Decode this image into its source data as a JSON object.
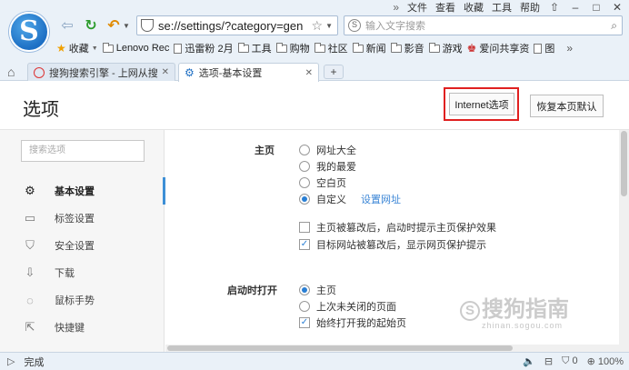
{
  "menubar": {
    "more": "»",
    "items": [
      "文件",
      "查看",
      "收藏",
      "工具",
      "帮助"
    ],
    "skin": "⇧",
    "minimize": "–",
    "maximize": "□",
    "close": "✕"
  },
  "logo": {
    "letter": "S"
  },
  "address": {
    "url": "se://settings/?category=gen"
  },
  "search": {
    "placeholder": "输入文字搜索"
  },
  "bookmarks": {
    "favorites": "收藏",
    "items": [
      "Lenovo Rec",
      "迅雷粉 2月",
      "工具",
      "购物",
      "社区",
      "新闻",
      "影音",
      "游戏",
      "爱问共享资",
      "图"
    ],
    "more": "»"
  },
  "tabs": [
    {
      "label": "搜狗搜索引擎 - 上网从搜",
      "active": false
    },
    {
      "label": "选项-基本设置",
      "active": true
    }
  ],
  "newtab": "+",
  "settings": {
    "title": "选项",
    "ie_button": "Internet选项",
    "reset_button": "恢复本页默认",
    "sidebar_search_placeholder": "搜索选项",
    "sidebar": [
      {
        "label": "基本设置",
        "icon": "⚙",
        "active": true
      },
      {
        "label": "标签设置",
        "icon": "▭",
        "active": false
      },
      {
        "label": "安全设置",
        "icon": "⛉",
        "active": false
      },
      {
        "label": "下载",
        "icon": "⇩",
        "active": false
      },
      {
        "label": "鼠标手势",
        "icon": "◌",
        "active": false
      },
      {
        "label": "快捷键",
        "icon": "⇱",
        "active": false
      }
    ],
    "homepage": {
      "label": "主页",
      "options": [
        "网址大全",
        "我的最爱",
        "空白页",
        "自定义"
      ],
      "selected": 3,
      "set_url_link": "设置网址",
      "checks": [
        {
          "label": "主页被篡改后，启动时提示主页保护效果",
          "checked": false
        },
        {
          "label": "目标网站被篡改后，显示网页保护提示",
          "checked": true
        }
      ]
    },
    "startup": {
      "label": "启动时打开",
      "options": [
        "主页",
        "上次未关闭的页面"
      ],
      "selected": 0,
      "check": {
        "label": "始终打开我的起始页",
        "checked": true
      }
    }
  },
  "watermark": {
    "circle": "S",
    "text": "搜狗指南",
    "sub": "zhinan.sogou.com"
  },
  "status": {
    "text": "完成",
    "count": "0",
    "zoom": "100%"
  }
}
